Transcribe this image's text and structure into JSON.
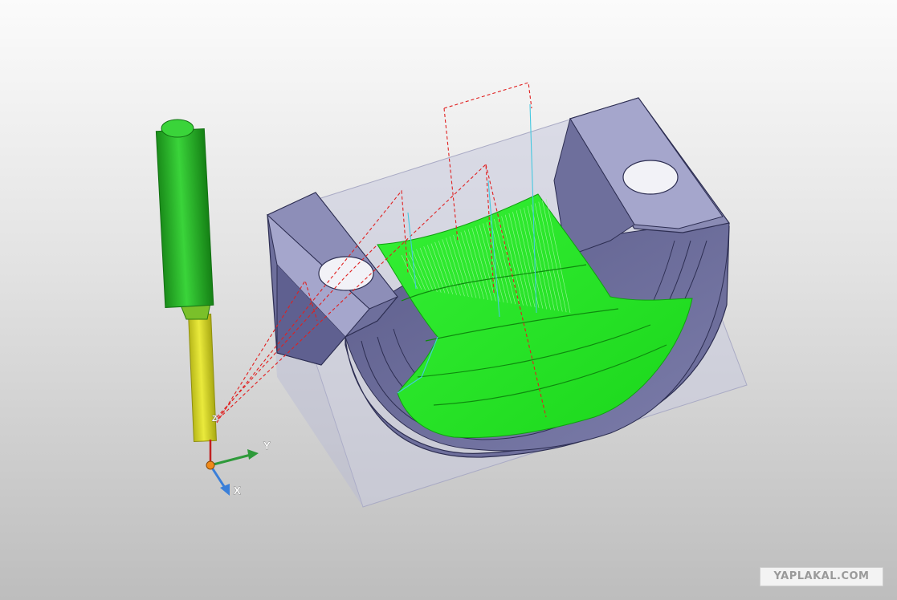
{
  "triad": {
    "x_label": "X",
    "y_label": "Y",
    "z_label": "Z"
  },
  "watermark": {
    "text": "YAPLAKAL.COM"
  },
  "colors": {
    "background_top": "#fbfbfb",
    "background_bottom": "#bdbdbd",
    "part": "#8a8bb4",
    "part_top_face": "#a5a6cc",
    "part_edge": "#2d2e52",
    "stock_box": "#c9cade",
    "toolpath": "#22e622",
    "tool_shank": "#22c022",
    "tool_flute": "#d9d92a",
    "rapid_moves": "#e02020",
    "link_moves": "#45c8e0",
    "axis_x": "#3a7fd9",
    "axis_y": "#2e9a3a",
    "axis_z": "#c02020"
  }
}
